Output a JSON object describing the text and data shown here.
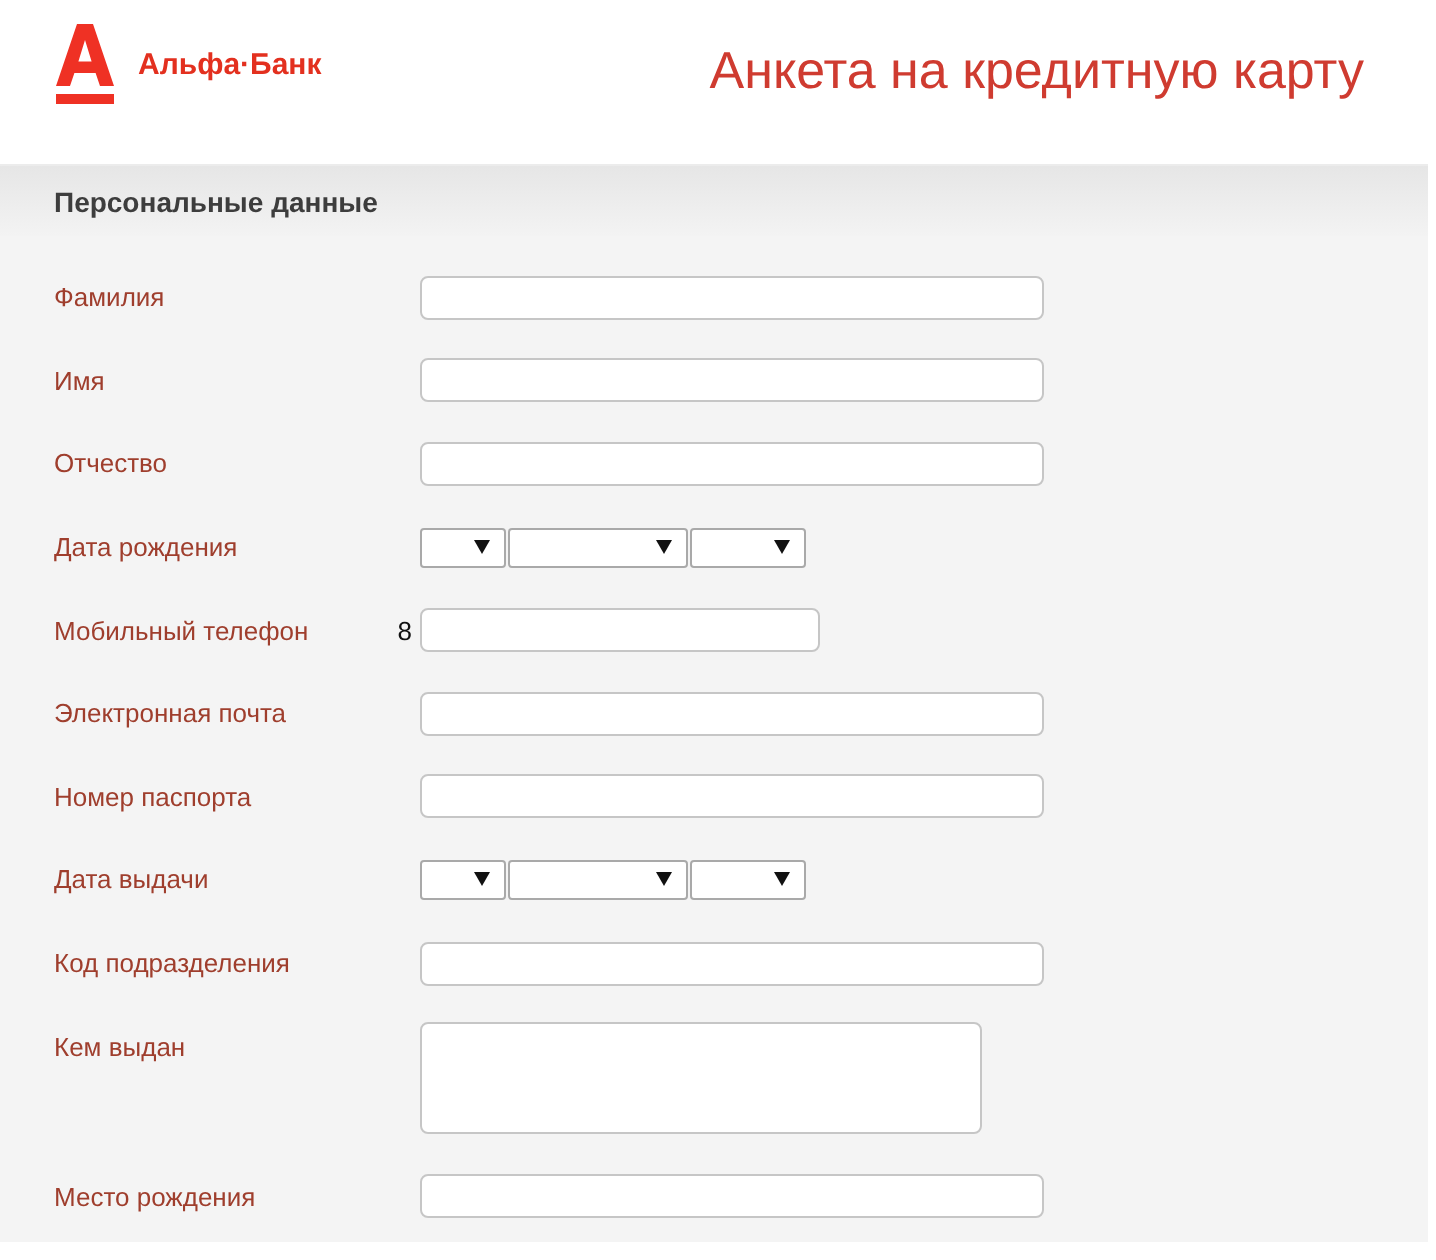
{
  "header": {
    "bank_name": "Альфа·Банк",
    "title": "Анкета на кредитную карту"
  },
  "section": {
    "title": "Персональные данные",
    "fields": [
      {
        "label": "Фамилия",
        "kind": "text"
      },
      {
        "label": "Имя",
        "kind": "text"
      },
      {
        "label": "Отчество",
        "kind": "text"
      },
      {
        "label": "Дата рождения",
        "kind": "date"
      },
      {
        "label": "Мобильный телефон",
        "kind": "phone",
        "prefix": "8"
      },
      {
        "label": "Электронная почта",
        "kind": "text"
      },
      {
        "label": "Номер паспорта",
        "kind": "text"
      },
      {
        "label": "Дата выдачи",
        "kind": "date"
      },
      {
        "label": "Код подразделения",
        "kind": "text"
      },
      {
        "label": "Кем выдан",
        "kind": "textarea"
      },
      {
        "label": "Место рождения",
        "kind": "text"
      }
    ]
  }
}
